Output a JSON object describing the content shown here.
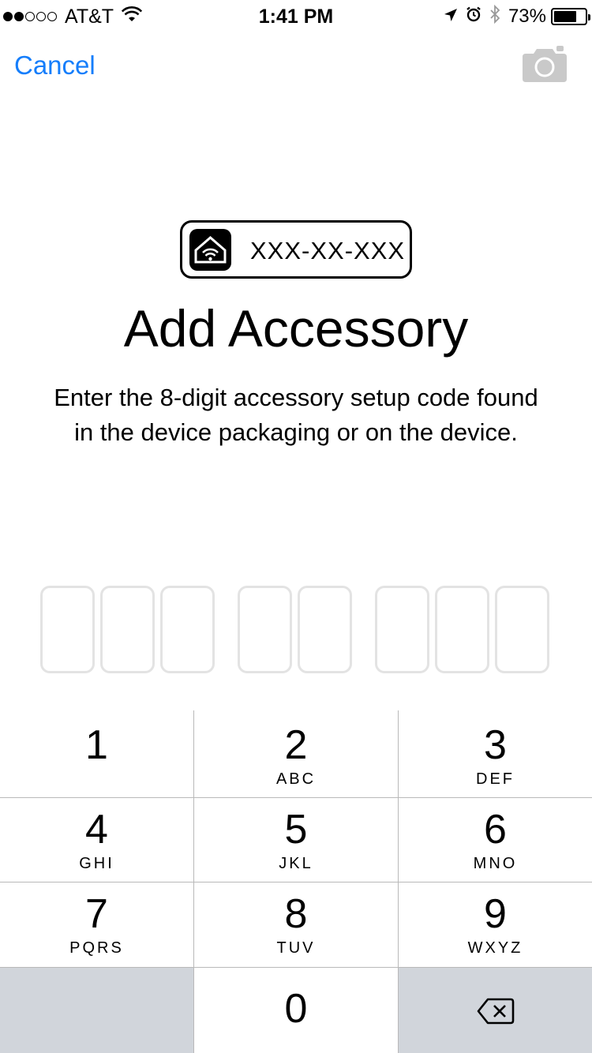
{
  "status_bar": {
    "carrier": "AT&T",
    "time": "1:41 PM",
    "battery_percent": "73%",
    "signal_bars_filled": 2,
    "signal_bars_total": 5
  },
  "nav": {
    "cancel_label": "Cancel",
    "camera_icon": "camera-icon"
  },
  "code_label": {
    "icon": "homekit-icon",
    "placeholder": "XXX-XX-XXX"
  },
  "title": "Add Accessory",
  "description": "Enter the 8-digit accessory setup code found in the device packaging or on the device.",
  "code_slots": [
    "",
    "",
    "",
    "",
    "",
    "",
    "",
    ""
  ],
  "keypad": {
    "keys": [
      {
        "num": "1",
        "letters": ""
      },
      {
        "num": "2",
        "letters": "ABC"
      },
      {
        "num": "3",
        "letters": "DEF"
      },
      {
        "num": "4",
        "letters": "GHI"
      },
      {
        "num": "5",
        "letters": "JKL"
      },
      {
        "num": "6",
        "letters": "MNO"
      },
      {
        "num": "7",
        "letters": "PQRS"
      },
      {
        "num": "8",
        "letters": "TUV"
      },
      {
        "num": "9",
        "letters": "WXYZ"
      },
      {
        "num": "0",
        "letters": ""
      }
    ],
    "delete_icon": "backspace-icon"
  },
  "colors": {
    "accent": "#157efb",
    "slot_border": "#e3e3e3",
    "keypad_gray": "#d1d5db"
  }
}
